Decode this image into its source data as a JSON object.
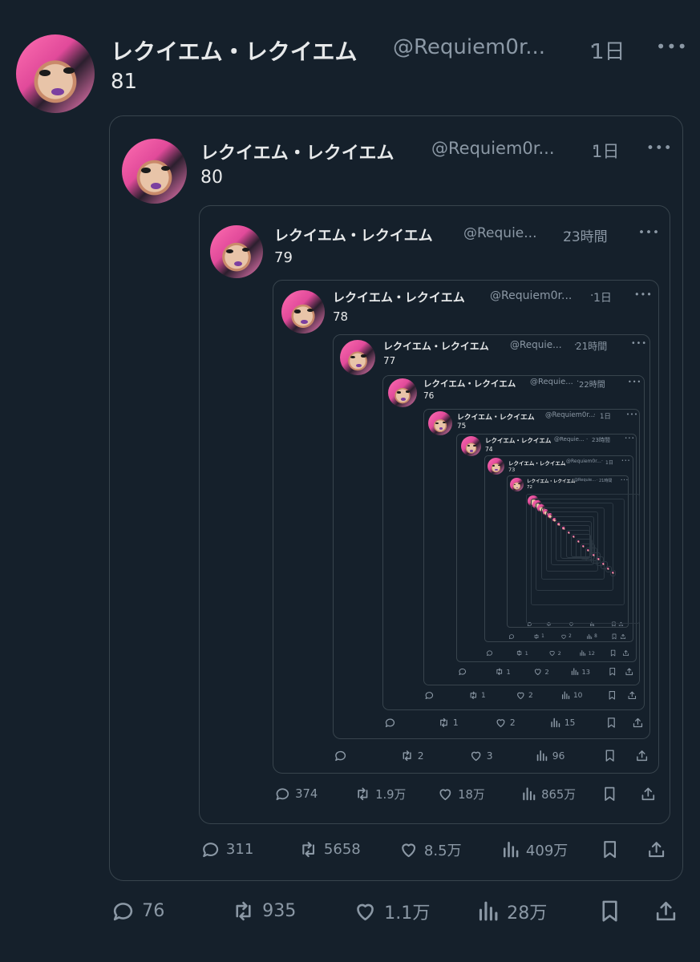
{
  "display_name": "レクイエム・レクイエム",
  "posts": [
    {
      "handle": "@Requiem0r...",
      "time": "1日",
      "text": "81",
      "actions": {
        "reply": "76",
        "repost": "935",
        "like": "1.1万",
        "views": "28万"
      }
    },
    {
      "handle": "@Requiem0r...",
      "time": "1日",
      "text": "80",
      "actions": {
        "reply": "311",
        "repost": "5658",
        "like": "8.5万",
        "views": "409万"
      }
    },
    {
      "handle": "@Requie...",
      "time": "23時間",
      "text": "79",
      "actions": {
        "reply": "374",
        "repost": "1.9万",
        "like": "18万",
        "views": "865万"
      }
    },
    {
      "handle": "@Requiem0r...",
      "time": "1日",
      "text": "78",
      "actions": {
        "reply": "",
        "repost": "2",
        "like": "3",
        "views": "96"
      }
    },
    {
      "handle": "@Requie...",
      "time": "21時間",
      "text": "77",
      "actions": {
        "reply": "",
        "repost": "1",
        "like": "2",
        "views": "15"
      }
    },
    {
      "handle": "@Requie...",
      "time": "22時間",
      "text": "76",
      "actions": {
        "reply": "",
        "repost": "1",
        "like": "2",
        "views": "10"
      }
    },
    {
      "handle": "@Requiem0r...",
      "time": "1日",
      "text": "75",
      "actions": {
        "reply": "",
        "repost": "1",
        "like": "2",
        "views": "13"
      }
    },
    {
      "handle": "@Requie...",
      "time": "23時間",
      "text": "74",
      "actions": {
        "reply": "",
        "repost": "1",
        "like": "2",
        "views": "12"
      }
    },
    {
      "handle": "@Requiem0r...",
      "time": "1日",
      "text": "73",
      "actions": {
        "reply": "",
        "repost": "1",
        "like": "2",
        "views": "8"
      }
    },
    {
      "handle": "@Requie...",
      "time": "21時間",
      "text": "72",
      "actions": {
        "reply": "",
        "repost": "",
        "like": "",
        "views": ""
      }
    }
  ],
  "more_label": "•••",
  "icons": [
    "reply-icon",
    "repost-icon",
    "like-icon",
    "views-icon",
    "bookmark-icon",
    "share-icon"
  ],
  "colors": {
    "background": "#15202b",
    "border": "#38444d",
    "text": "#e7e9ea",
    "muted": "#8b98a5",
    "avatar_hair": "#ff6fb1"
  }
}
